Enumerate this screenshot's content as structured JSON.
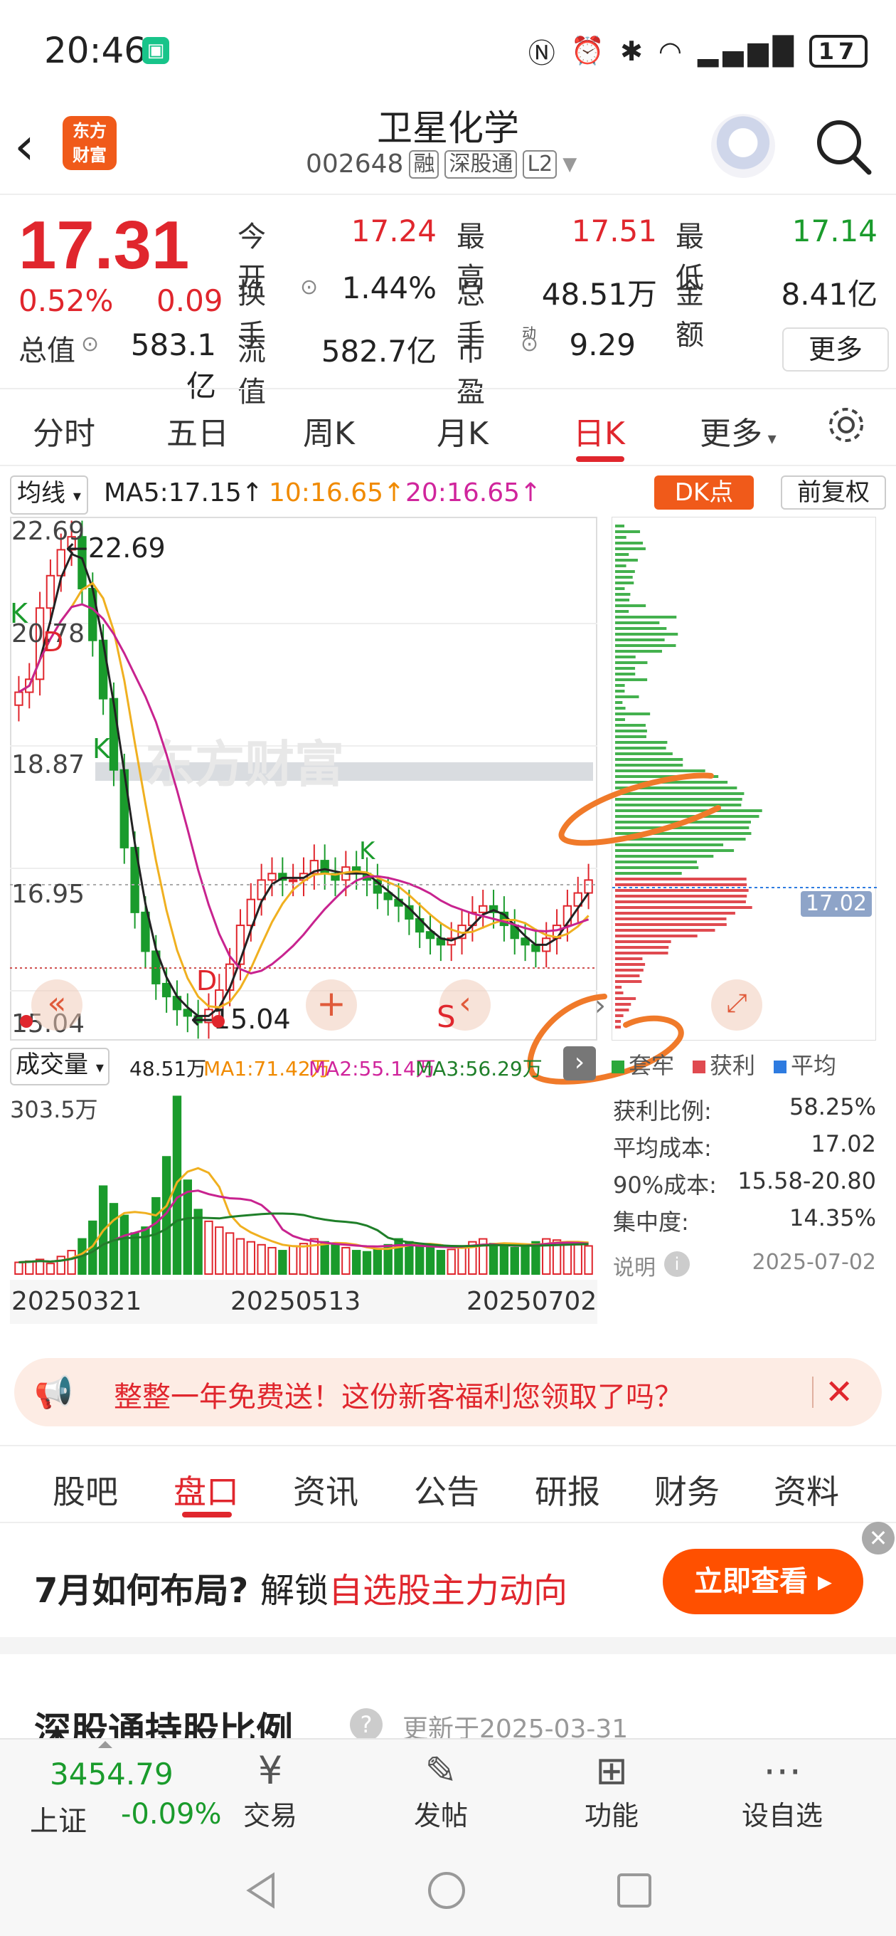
{
  "status_bar": {
    "time": "20:46",
    "battery": "17"
  },
  "header": {
    "logo_text": "东方财富",
    "stock_name": "卫星化学",
    "stock_code": "002648",
    "tags": [
      "融",
      "深股通",
      "L2"
    ]
  },
  "quote": {
    "price": "17.31",
    "pct_change": "0.52%",
    "change": "0.09",
    "rows": [
      [
        {
          "label": "今开",
          "value": "17.24",
          "color": "red"
        },
        {
          "label": "最高",
          "value": "17.51",
          "color": "red"
        },
        {
          "label": "最低",
          "value": "17.14",
          "color": "green"
        }
      ],
      [
        {
          "label": "换手",
          "value": "1.44%",
          "color": "dark"
        },
        {
          "label": "总手",
          "value": "48.51万",
          "color": "dark"
        },
        {
          "label": "金额",
          "value": "8.41亿",
          "color": "dark"
        }
      ],
      [
        {
          "label": "总值",
          "value": "583.1亿",
          "color": "dark"
        },
        {
          "label": "流值",
          "value": "582.7亿",
          "color": "dark"
        },
        {
          "label": "市盈",
          "value": "9.29",
          "color": "dark"
        }
      ]
    ],
    "pe_superscript": "动",
    "more_label": "更多"
  },
  "period_tabs": [
    "分时",
    "五日",
    "周K",
    "月K",
    "日K",
    "更多"
  ],
  "active_period": "日K",
  "ma_bar": {
    "select_label": "均线",
    "ma5": "MA5:17.15↑",
    "ma10": "10:16.65↑",
    "ma20": "20:16.65↑",
    "dk_label": "DK点",
    "fq_label": "前复权"
  },
  "kline": {
    "y_labels": [
      "22.69",
      "20.78",
      "18.87",
      "16.95",
      "15.04"
    ],
    "high_label": "←22.69",
    "low_label": "←15.04",
    "watermark": "东方财富",
    "markers": [
      "K",
      "D",
      "K",
      "K",
      "D"
    ],
    "s_label": "S",
    "price_tag": "17.02"
  },
  "volume": {
    "select_label": "成交量",
    "vol": "48.51万",
    "ma1": "MA1:71.42万",
    "ma2": "MA2:55.14万",
    "ma3": "MA3:56.29万",
    "max_label": "303.5万",
    "dates": [
      "20250321",
      "20250513",
      "20250702"
    ]
  },
  "chip": {
    "legend": [
      "套牢",
      "获利",
      "平均"
    ],
    "stats": [
      {
        "label": "获利比例:",
        "value": "58.25%"
      },
      {
        "label": "平均成本:",
        "value": "17.02"
      },
      {
        "label": "90%成本:",
        "value": "15.58-20.80"
      },
      {
        "label": "集中度:",
        "value": "14.35%"
      }
    ],
    "note_label": "说明",
    "note_date": "2025-07-02"
  },
  "promo": {
    "text": "整整一年免费送！这份新客福利您领取了吗？"
  },
  "content_tabs": [
    "股吧",
    "盘口",
    "资讯",
    "公告",
    "研报",
    "财务",
    "资料"
  ],
  "active_content_tab": "盘口",
  "ad": {
    "prefix": "7月如何布局?",
    "middle": "解锁",
    "highlight": "自选股主力动向",
    "button": "立即查看 ▸"
  },
  "hk_section": {
    "title": "深股通持股比例",
    "updated": "更新于2025-03-31"
  },
  "bottom_nav": {
    "index_value": "3454.79",
    "index_name": "上证",
    "index_change": "-0.09%",
    "items": [
      "交易",
      "发帖",
      "功能",
      "设自选"
    ]
  },
  "colors": {
    "up": "#e0262d",
    "down": "#1a9b2c",
    "accent": "#f05a1a"
  }
}
